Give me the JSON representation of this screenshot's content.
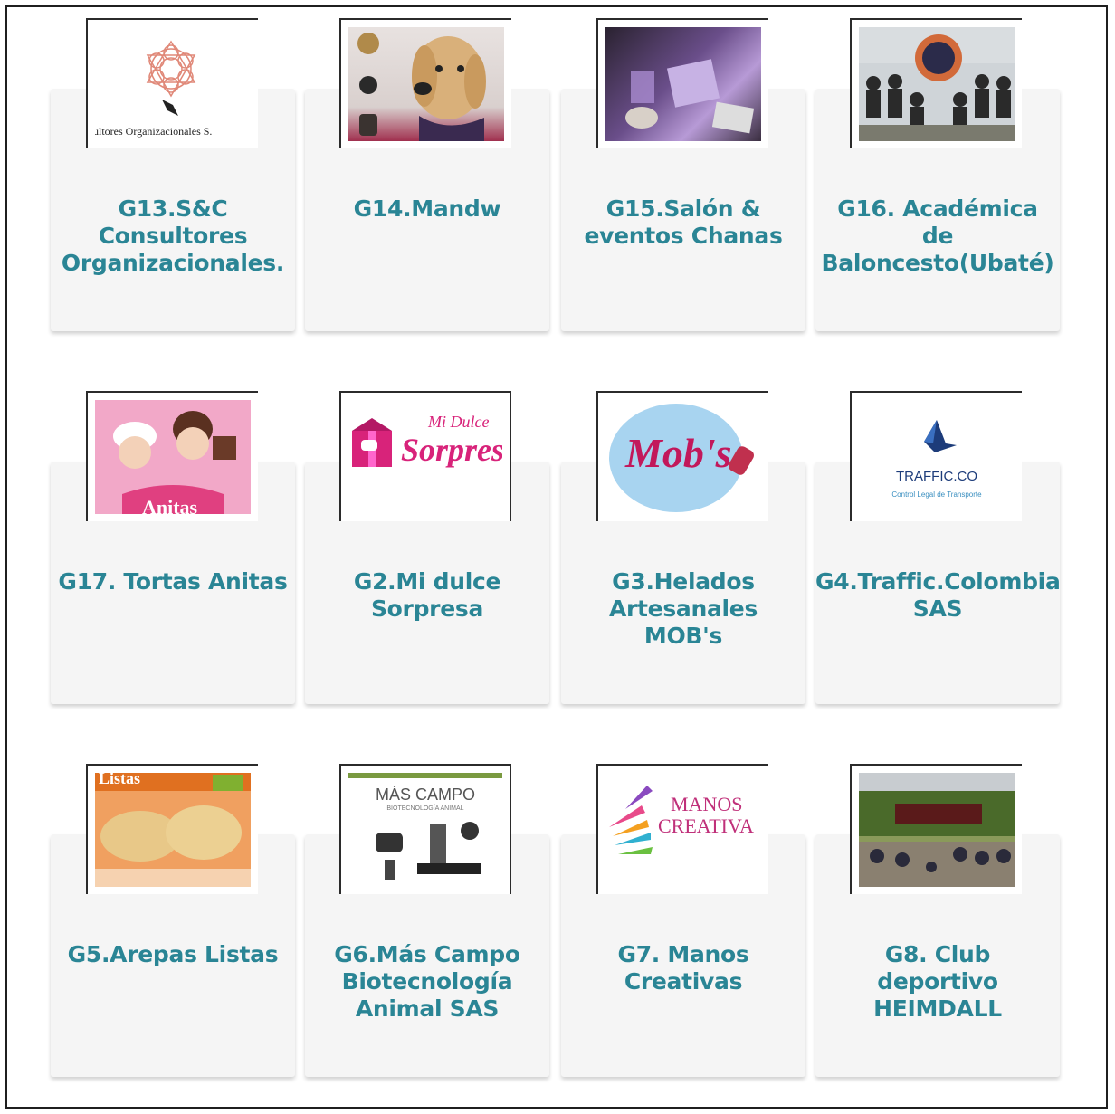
{
  "cards": [
    {
      "title": "G13.S&C\nConsultores\nOrganizacionales.",
      "logo_text": "ultores Organizacionales S."
    },
    {
      "title": "G14.Mandw"
    },
    {
      "title": "G15.Salón &\neventos Chanas"
    },
    {
      "title": "G16. Académica\nde\nBaloncesto(Ubaté)"
    },
    {
      "title": "G17. Tortas Anitas",
      "logo_text": "Anitas"
    },
    {
      "title": "G2.Mi dulce\nSorpresa",
      "logo_text_1": "Mi Dulce",
      "logo_text_2": "Sorpresa"
    },
    {
      "title": "G3.Helados\nArtesanales\nMOB's",
      "logo_text": "Mob's"
    },
    {
      "title": "G4.Traffic.Colombia\nSAS",
      "logo_text": "TRAFFIC.CO",
      "logo_subtext": "Control Legal de Transporte"
    },
    {
      "title": "G5.Arepas Listas",
      "logo_text": "Listas"
    },
    {
      "title": "G6.Más Campo\nBiotecnología\nAnimal SAS",
      "logo_text": "MÁS CAMPO",
      "logo_subtext": "BIOTECNOLOGÍA ANIMAL"
    },
    {
      "title": "G7. Manos\nCreativas",
      "logo_text_1": "MANOS",
      "logo_text_2": "CREATIVA"
    },
    {
      "title": "G8. Club\ndeportivo\nHEIMDALL"
    }
  ],
  "colors": {
    "title": "#2a8595",
    "card_bg": "#f5f5f5"
  }
}
